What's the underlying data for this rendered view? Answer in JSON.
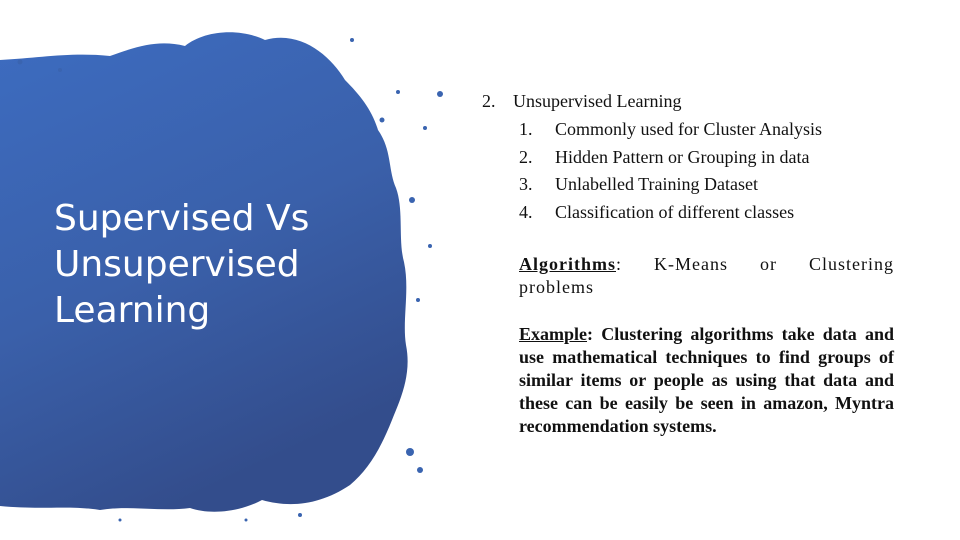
{
  "slide": {
    "title_lines": [
      "Supervised Vs",
      "Unsupervised",
      "Learning"
    ],
    "blob_color": "#3a64b0",
    "main_item": {
      "number": "2.",
      "text": "Unsupervised Learning"
    },
    "sub_items": [
      {
        "number": "1.",
        "text": "Commonly used for Cluster Analysis"
      },
      {
        "number": "2.",
        "text": "Hidden Pattern or Grouping in data"
      },
      {
        "number": "3.",
        "text": "Unlabelled Training Dataset"
      },
      {
        "number": "4.",
        "text": "Classification of different classes"
      }
    ],
    "algorithms": {
      "label": "Algorithms",
      "sep": ":",
      "text": " K-Means or Clustering problems"
    },
    "example": {
      "label": "Example",
      "sep": ":",
      "text": " Clustering algorithms take data and use mathematical techniques to find groups of similar items or people as using that data and these can be easily be seen in amazon, Myntra recommendation systems."
    }
  }
}
